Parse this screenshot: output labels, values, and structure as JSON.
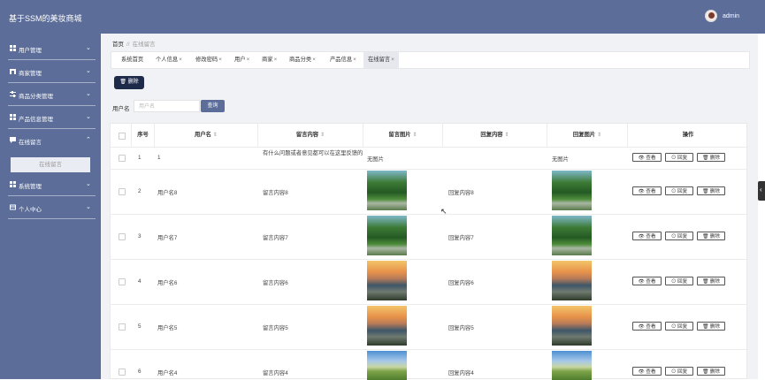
{
  "app": {
    "title": "基于SSM的美妆商城",
    "user": "admin"
  },
  "sidebar": {
    "items": [
      {
        "label": "用户管理"
      },
      {
        "label": "商家管理"
      },
      {
        "label": "商品分类管理"
      },
      {
        "label": "产品信息管理"
      },
      {
        "label": "在线留言"
      },
      {
        "label": "系统管理"
      },
      {
        "label": "个人中心"
      }
    ],
    "subitem": "在线留言"
  },
  "breadcrumb": {
    "home": "首页",
    "separator": "//",
    "current": "在线留言"
  },
  "tabs": [
    {
      "label": "系统首页",
      "close": ""
    },
    {
      "label": "个人信息",
      "close": "×"
    },
    {
      "label": "修改密码",
      "close": "×"
    },
    {
      "label": "用户",
      "close": "×"
    },
    {
      "label": "商家",
      "close": "×"
    },
    {
      "label": "商品分类",
      "close": "×"
    },
    {
      "label": "产品信息",
      "close": "×"
    },
    {
      "label": "在线留言",
      "close": "×"
    }
  ],
  "toolbar": {
    "delete_label": "删除"
  },
  "search": {
    "label": "用户名",
    "placeholder": "用户名",
    "button": "查询"
  },
  "table": {
    "headers": {
      "index": "序号",
      "username": "用户名",
      "message": "留言内容",
      "message_image": "留言图片",
      "reply": "回复内容",
      "reply_image": "回复图片",
      "actions": "操作"
    },
    "sort_icon": "⇕",
    "action_labels": {
      "view": "查看",
      "reply": "回复",
      "delete": "删除"
    },
    "rows": [
      {
        "index": "1",
        "username": "1",
        "message": "有什么问题或者意见都可以在这里反馈的",
        "message_image": "无图片",
        "reply": "",
        "reply_image": "无图片"
      },
      {
        "index": "2",
        "username": "用户名8",
        "message": "留言内容8",
        "reply": "回复内容8",
        "image_style": "green"
      },
      {
        "index": "3",
        "username": "用户名7",
        "message": "留言内容7",
        "reply": "回复内容7",
        "image_style": "green"
      },
      {
        "index": "4",
        "username": "用户名6",
        "message": "留言内容6",
        "reply": "回复内容6",
        "image_style": "sunset"
      },
      {
        "index": "5",
        "username": "用户名5",
        "message": "留言内容5",
        "reply": "回复内容5",
        "image_style": "sunset"
      },
      {
        "index": "6",
        "username": "用户名4",
        "message": "留言内容4",
        "reply": "回复内容4",
        "image_style": "meadow"
      }
    ]
  },
  "colors": {
    "primary": "#5b6d98",
    "dark_button": "#1e2a4a",
    "background": "#f1f2f5"
  }
}
